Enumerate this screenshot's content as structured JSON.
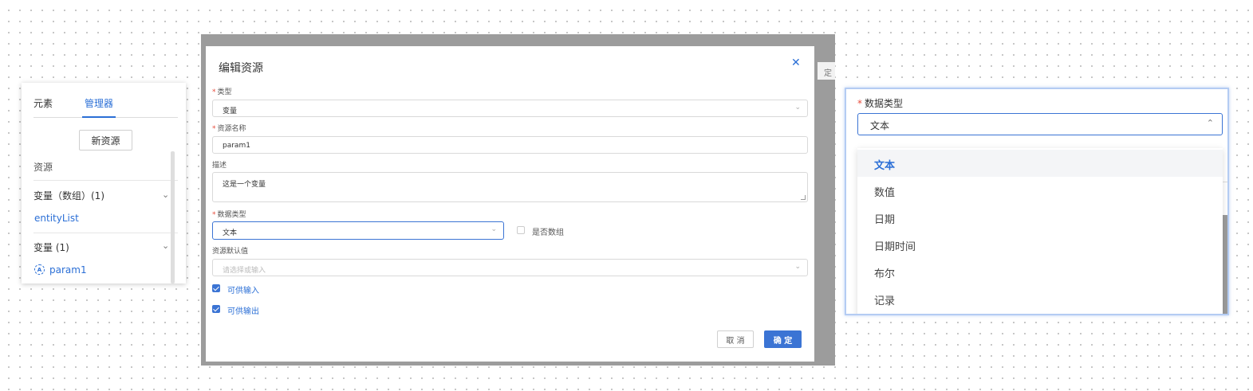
{
  "manager": {
    "tabs": [
      "元素",
      "管理器"
    ],
    "new_resource_button": "新资源",
    "resources_label": "资源",
    "groups": [
      {
        "title": "变量（数组）(1)",
        "items": [
          "entityList"
        ]
      },
      {
        "title": "变量 (1)",
        "items": [
          "param1"
        ]
      }
    ],
    "variable_icon_glyph": "A"
  },
  "modal": {
    "title": "编辑资源",
    "close_glyph": "✕",
    "background_peek": "定",
    "fields": {
      "type": {
        "label": "类型",
        "value": "变量"
      },
      "name": {
        "label": "资源名称",
        "value": "param1"
      },
      "description": {
        "label": "描述",
        "value": "这是一个变量"
      },
      "data_type": {
        "label": "数据类型",
        "value": "文本"
      },
      "is_array": {
        "label": "是否数组",
        "checked": false
      },
      "default_value": {
        "label": "资源默认值",
        "placeholder": "请选择或输入"
      }
    },
    "checkboxes": [
      {
        "label": "可供输入",
        "checked": true
      },
      {
        "label": "可供输出",
        "checked": true
      }
    ],
    "cancel_label": "取 消",
    "ok_label": "确 定",
    "accent_color": "#3b74d4"
  },
  "zoom": {
    "label": "数据类型",
    "selected": "文本",
    "options": [
      "文本",
      "数值",
      "日期",
      "日期时间",
      "布尔",
      "记录"
    ],
    "active_index": 0
  }
}
